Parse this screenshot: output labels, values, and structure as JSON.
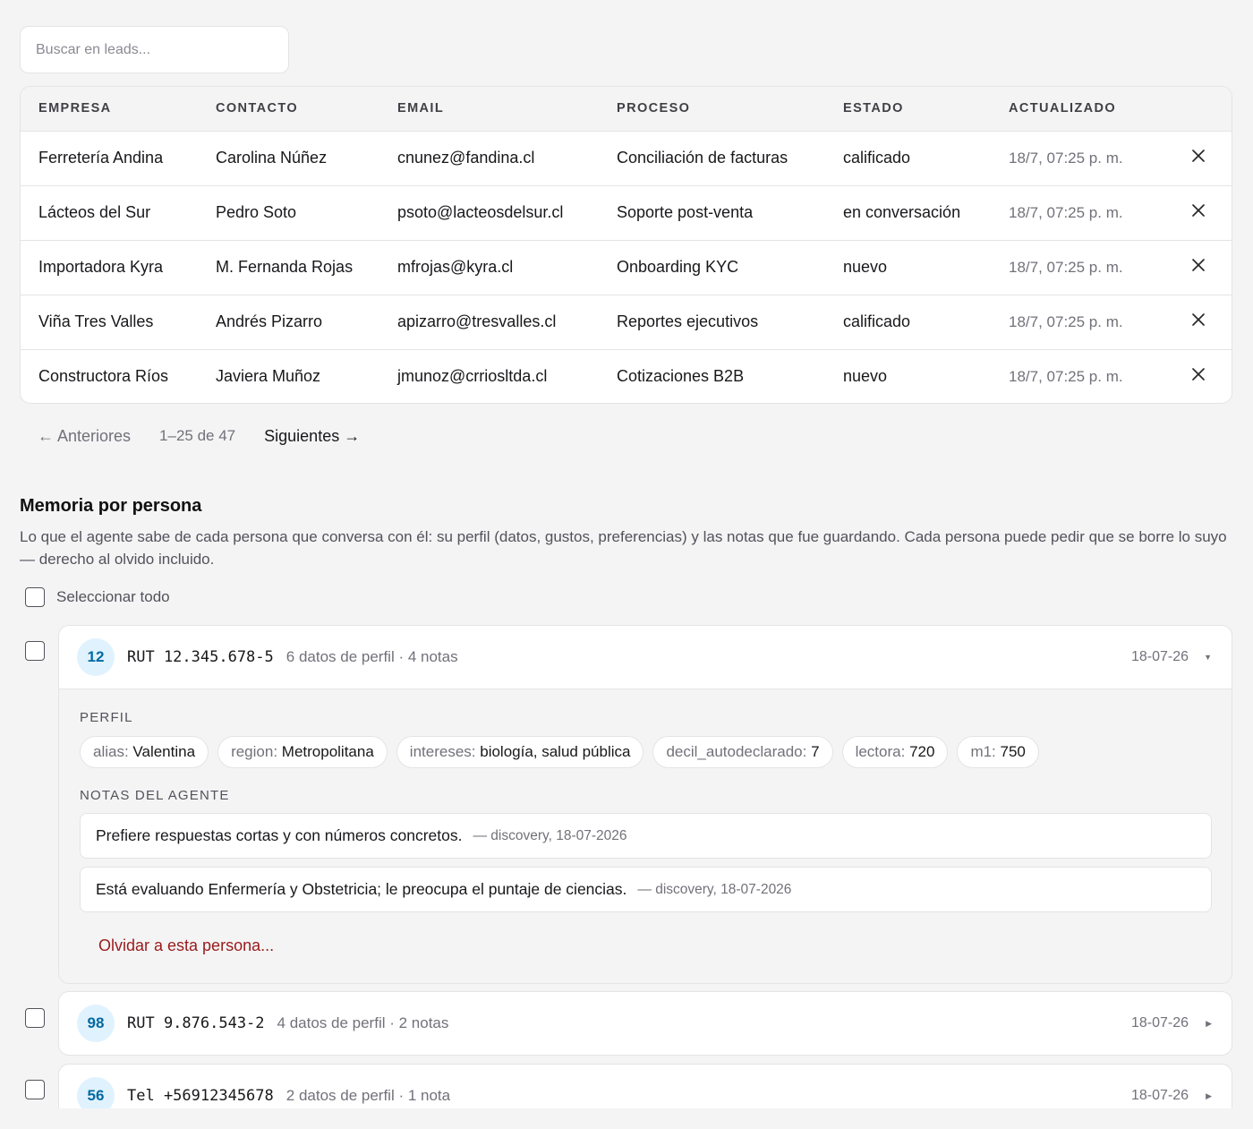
{
  "search": {
    "placeholder": "Buscar en leads..."
  },
  "table": {
    "headers": [
      "EMPRESA",
      "CONTACTO",
      "EMAIL",
      "PROCESO",
      "ESTADO",
      "ACTUALIZADO"
    ],
    "rows": [
      {
        "empresa": "Ferretería Andina",
        "contacto": "Carolina Núñez",
        "email": "cnunez@fandina.cl",
        "proceso": "Conciliación de facturas",
        "estado": "calificado",
        "actualizado": "18/7, 07:25 p. m."
      },
      {
        "empresa": "Lácteos del Sur",
        "contacto": "Pedro Soto",
        "email": "psoto@lacteosdelsur.cl",
        "proceso": "Soporte post-venta",
        "estado": "en conversación",
        "actualizado": "18/7, 07:25 p. m."
      },
      {
        "empresa": "Importadora Kyra",
        "contacto": "M. Fernanda Rojas",
        "email": "mfrojas@kyra.cl",
        "proceso": "Onboarding KYC",
        "estado": "nuevo",
        "actualizado": "18/7, 07:25 p. m."
      },
      {
        "empresa": "Viña Tres Valles",
        "contacto": "Andrés Pizarro",
        "email": "apizarro@tresvalles.cl",
        "proceso": "Reportes ejecutivos",
        "estado": "calificado",
        "actualizado": "18/7, 07:25 p. m."
      },
      {
        "empresa": "Constructora Ríos",
        "contacto": "Javiera Muñoz",
        "email": "jmunoz@crriosltda.cl",
        "proceso": "Cotizaciones B2B",
        "estado": "nuevo",
        "actualizado": "18/7, 07:25 p. m."
      }
    ]
  },
  "pagination": {
    "prev": "← Anteriores",
    "info": "1–25 de 47",
    "next": "Siguientes →"
  },
  "memory": {
    "title": "Memoria por persona",
    "description": "Lo que el agente sabe de cada persona que conversa con él: su perfil (datos, gustos, preferencias) y las notas que fue guardando. Cada persona puede pedir que se borre lo suyo — derecho al olvido incluido.",
    "select_all": "Seleccionar todo",
    "persons": [
      {
        "badge": "12",
        "id": "RUT 12.345.678-5",
        "summary": "6 datos de perfil · 4 notas",
        "date": "18-07-26",
        "expanded": true,
        "profile_label": "PERFIL",
        "profile": [
          {
            "key": "alias:",
            "value": "Valentina"
          },
          {
            "key": "region:",
            "value": "Metropolitana"
          },
          {
            "key": "intereses:",
            "value": "biología, salud pública"
          },
          {
            "key": "decil_autodeclarado:",
            "value": "7"
          },
          {
            "key": "lectora:",
            "value": "720"
          },
          {
            "key": "m1:",
            "value": "750"
          }
        ],
        "notes_label": "NOTAS DEL AGENTE",
        "notes": [
          {
            "text": "Prefiere respuestas cortas y con números concretos.",
            "meta": "— discovery, 18-07-2026"
          },
          {
            "text": "Está evaluando Enfermería y Obstetricia; le preocupa el puntaje de ciencias.",
            "meta": "— discovery, 18-07-2026"
          }
        ],
        "forget": "Olvidar a esta persona..."
      },
      {
        "badge": "98",
        "id": "RUT 9.876.543-2",
        "summary": "4 datos de perfil · 2 notas",
        "date": "18-07-26",
        "expanded": false
      },
      {
        "badge": "56",
        "id": "Tel +56912345678",
        "summary": "2 datos de perfil · 1 nota",
        "date": "18-07-26",
        "expanded": false
      }
    ]
  },
  "icons": {
    "row_remove": "close-icon",
    "expand": "caret-down-icon",
    "collapse": "caret-right-icon"
  },
  "colors": {
    "avatar_bg": "#e0f2fe",
    "avatar_text": "#0369a1",
    "danger": "#991b1b",
    "page_bg": "#f4f4f5"
  }
}
